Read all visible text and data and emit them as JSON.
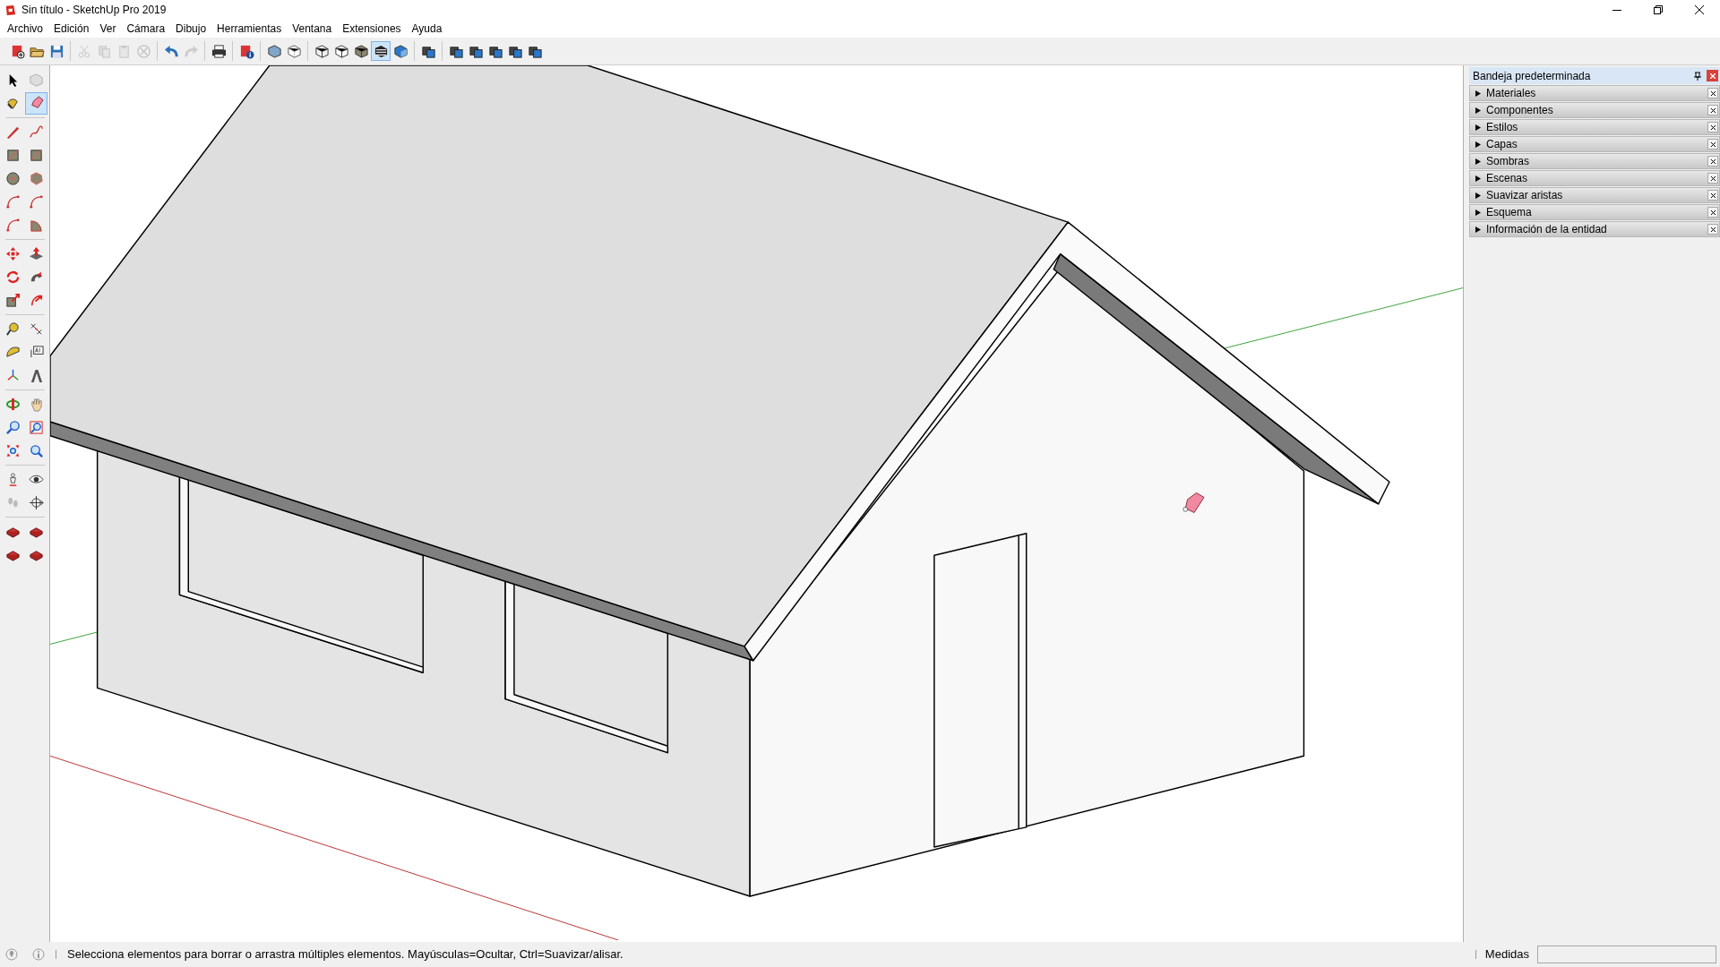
{
  "window": {
    "title": "Sin título - SketchUp Pro 2019"
  },
  "menu": [
    "Archivo",
    "Edición",
    "Ver",
    "Cámara",
    "Dibujo",
    "Herramientas",
    "Ventana",
    "Extensiones",
    "Ayuda"
  ],
  "toolbar": [
    [
      {
        "kind": "new",
        "selected": false,
        "disabled": false
      },
      {
        "kind": "open",
        "selected": false,
        "disabled": false
      },
      {
        "kind": "save",
        "selected": false,
        "disabled": false
      }
    ],
    [
      {
        "kind": "cut",
        "selected": false,
        "disabled": true
      },
      {
        "kind": "copy",
        "selected": false,
        "disabled": true
      },
      {
        "kind": "paste",
        "selected": false,
        "disabled": true
      },
      {
        "kind": "delete",
        "selected": false,
        "disabled": true
      }
    ],
    [
      {
        "kind": "undo",
        "selected": false,
        "disabled": false
      },
      {
        "kind": "redo",
        "selected": false,
        "disabled": true
      }
    ],
    [
      {
        "kind": "print",
        "selected": false,
        "disabled": false
      }
    ],
    [
      {
        "kind": "info",
        "selected": false,
        "disabled": false
      }
    ],
    [
      {
        "kind": "xray",
        "selected": false,
        "disabled": false
      },
      {
        "kind": "backedges",
        "selected": false,
        "disabled": false
      }
    ],
    [
      {
        "kind": "wireframe",
        "selected": false,
        "disabled": false
      },
      {
        "kind": "hiddenline",
        "selected": false,
        "disabled": false
      },
      {
        "kind": "shaded",
        "selected": false,
        "disabled": false
      },
      {
        "kind": "textured",
        "selected": true,
        "disabled": false
      },
      {
        "kind": "monochrome",
        "selected": false,
        "disabled": false
      }
    ],
    [
      {
        "kind": "views",
        "selected": false,
        "disabled": false
      }
    ],
    [
      {
        "kind": "views",
        "selected": false,
        "disabled": false
      },
      {
        "kind": "views",
        "selected": false,
        "disabled": false
      },
      {
        "kind": "views",
        "selected": false,
        "disabled": false
      },
      {
        "kind": "views",
        "selected": false,
        "disabled": false
      },
      {
        "kind": "views",
        "selected": false,
        "disabled": false
      }
    ]
  ],
  "tools": [
    [
      {
        "kind": "select",
        "selected": false
      },
      {
        "kind": "component",
        "selected": false
      },
      {
        "kind": "paint",
        "selected": false
      },
      {
        "kind": "eraser",
        "selected": true
      }
    ],
    [
      {
        "kind": "pencil",
        "selected": false
      },
      {
        "kind": "freehand",
        "selected": false
      },
      {
        "kind": "rectangle",
        "selected": false
      },
      {
        "kind": "rectangle",
        "selected": false
      },
      {
        "kind": "circle",
        "selected": false
      },
      {
        "kind": "polygon",
        "selected": false
      },
      {
        "kind": "arc",
        "selected": false
      },
      {
        "kind": "arc",
        "selected": false
      },
      {
        "kind": "arc",
        "selected": false
      },
      {
        "kind": "pie",
        "selected": false
      }
    ],
    [
      {
        "kind": "move",
        "selected": false
      },
      {
        "kind": "pushpull",
        "selected": false
      },
      {
        "kind": "rotate",
        "selected": false
      },
      {
        "kind": "followme",
        "selected": false
      },
      {
        "kind": "scale",
        "selected": false
      },
      {
        "kind": "offset",
        "selected": false
      }
    ],
    [
      {
        "kind": "tape",
        "selected": false
      },
      {
        "kind": "dimension",
        "selected": false
      },
      {
        "kind": "protractor",
        "selected": false
      },
      {
        "kind": "text",
        "selected": false
      },
      {
        "kind": "axes",
        "selected": false
      },
      {
        "kind": "text3d",
        "selected": false
      }
    ],
    [
      {
        "kind": "orbit",
        "selected": false
      },
      {
        "kind": "pan",
        "selected": false
      },
      {
        "kind": "zoom",
        "selected": false
      },
      {
        "kind": "zoomwindow",
        "selected": false
      },
      {
        "kind": "zoomextents",
        "selected": false
      },
      {
        "kind": "zoomprev",
        "selected": false
      }
    ],
    [
      {
        "kind": "camera",
        "selected": false
      },
      {
        "kind": "lookaround",
        "selected": false
      },
      {
        "kind": "walk",
        "selected": false
      },
      {
        "kind": "section",
        "selected": false
      }
    ],
    [
      {
        "kind": "warehouse",
        "selected": false
      },
      {
        "kind": "warehouse",
        "selected": false
      },
      {
        "kind": "warehouse",
        "selected": false
      },
      {
        "kind": "warehouse",
        "selected": false
      }
    ]
  ],
  "tray": {
    "title": "Bandeja predeterminada",
    "panels": [
      {
        "label": "Materiales",
        "expanded": false
      },
      {
        "label": "Componentes",
        "expanded": false
      },
      {
        "label": "Estilos",
        "expanded": false
      },
      {
        "label": "Capas",
        "expanded": false
      },
      {
        "label": "Sombras",
        "expanded": false
      },
      {
        "label": "Escenas",
        "expanded": false
      },
      {
        "label": "Suavizar aristas",
        "expanded": false
      },
      {
        "label": "Esquema",
        "expanded": false
      },
      {
        "label": "Información de la entidad",
        "expanded": false
      }
    ]
  },
  "status_bar": {
    "message": "Selecciona elementos para borrar o arrastra múltiples elementos. Mayúsculas=Ocultar, Ctrl=Suavizar/alisar.",
    "measurements_label": "Medidas"
  }
}
